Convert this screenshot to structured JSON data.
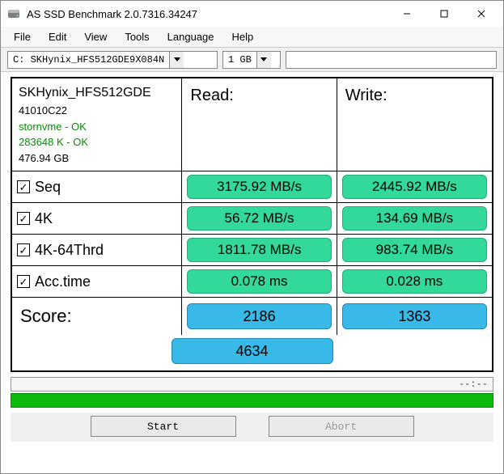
{
  "window": {
    "title": "AS SSD Benchmark 2.0.7316.34247"
  },
  "menu": {
    "file": "File",
    "edit": "Edit",
    "view": "View",
    "tools": "Tools",
    "language": "Language",
    "help": "Help"
  },
  "toolbar": {
    "drive_selected": "C: SKHynix_HFS512GDE9X084N",
    "size_selected": "1 GB",
    "search_value": ""
  },
  "info": {
    "model": "SKHynix_HFS512GDE",
    "firmware": "41010C22",
    "driver_status": "stornvme - OK",
    "align_status": "283648 K - OK",
    "capacity": "476.94 GB"
  },
  "headers": {
    "read": "Read:",
    "write": "Write:"
  },
  "tests": {
    "seq": {
      "label": "Seq",
      "checked": true,
      "read": "3175.92 MB/s",
      "write": "2445.92 MB/s"
    },
    "k4": {
      "label": "4K",
      "checked": true,
      "read": "56.72 MB/s",
      "write": "134.69 MB/s"
    },
    "k4_64": {
      "label": "4K-64Thrd",
      "checked": true,
      "read": "1811.78 MB/s",
      "write": "983.74 MB/s"
    },
    "acc": {
      "label": "Acc.time",
      "checked": true,
      "read": "0.078 ms",
      "write": "0.028 ms"
    }
  },
  "score": {
    "label": "Score:",
    "read": "2186",
    "write": "1363",
    "total": "4634"
  },
  "status": {
    "text": "--:--"
  },
  "buttons": {
    "start": "Start",
    "abort": "Abort"
  },
  "checkmark": "☑"
}
